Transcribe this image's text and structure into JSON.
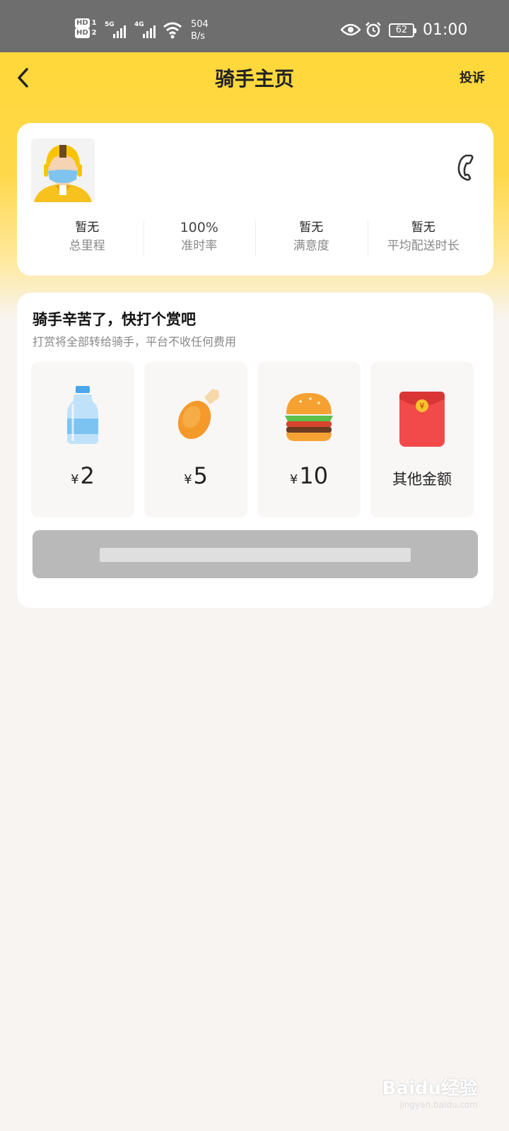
{
  "status_bar": {
    "hd1": "HD",
    "hd1_sim": "1",
    "hd2": "HD",
    "hd2_sim": "2",
    "net1": "5G",
    "net2": "4G",
    "speed_value": "504",
    "speed_unit": "B/s",
    "battery": "62",
    "time": "01:00"
  },
  "header": {
    "title": "骑手主页",
    "complain_label": "投诉",
    "back_icon": "chevron-left-icon"
  },
  "rider": {
    "avatar_icon": "rider-helmet-mask-avatar",
    "phone_icon": "phone-icon",
    "stats": [
      {
        "value": "暂无",
        "label": "总里程"
      },
      {
        "value": "100%",
        "label": "准时率"
      },
      {
        "value": "暂无",
        "label": "满意度"
      },
      {
        "value": "暂无",
        "label": "平均配送时长"
      }
    ]
  },
  "tip": {
    "title": "骑手辛苦了，快打个赏吧",
    "subtitle": "打赏将全部转给骑手，平台不收任何费用",
    "currency": "¥",
    "options": [
      {
        "icon": "water-bottle-icon",
        "amount": "2"
      },
      {
        "icon": "chicken-leg-icon",
        "amount": "5"
      },
      {
        "icon": "burger-icon",
        "amount": "10"
      },
      {
        "icon": "red-envelope-icon",
        "label": "其他金额"
      }
    ],
    "submit_button": "blurred"
  },
  "watermark": {
    "text": "Baidu经验",
    "sub": "jingyan.baidu.com"
  },
  "colors": {
    "header_yellow": "#ffd83a",
    "page_bg": "#f7f4f2",
    "card_bg": "#ffffff",
    "submit_disabled": "#b9b9b9",
    "status_bar": "#6e6e6e"
  }
}
